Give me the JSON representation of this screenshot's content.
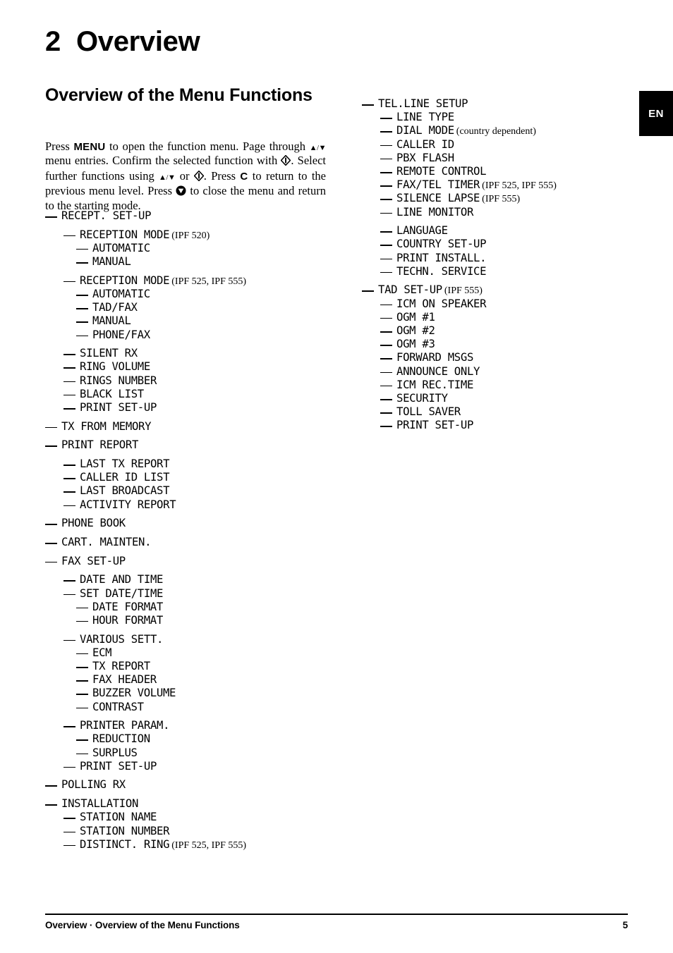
{
  "lang_tab": {
    "label": "EN"
  },
  "chapter": {
    "number": "2",
    "title": "Overview"
  },
  "section": {
    "title": "Overview of the Menu Functions"
  },
  "intro": {
    "t1": "Press ",
    "menu_key": "MENU",
    "t2": " to open the function menu. Page through ",
    "arrows1": "▲/▼",
    "t3": " menu entries. Confirm the selected function with ",
    "ok_symbol": "ok-diamond",
    "t4": ". Select further functions using ",
    "arrows2": "▲/▼",
    "t5": " or ",
    "ok_symbol2": "ok-diamond",
    "t6": ". Press ",
    "c_key": "C",
    "t7": " to return to the previous menu level. Press ",
    "stop_symbol": "stop-circle",
    "t8": " to close the menu and return to the starting mode."
  },
  "left_column": [
    {
      "level": 1,
      "label": "RECEPT. SET-UP",
      "note": "",
      "gap": false
    },
    {
      "level": 2,
      "label": "RECEPTION MODE",
      "note": "(IPF 520)",
      "gap": true
    },
    {
      "level": 3,
      "label": "AUTOMATIC",
      "note": "",
      "gap": false
    },
    {
      "level": 3,
      "label": "MANUAL",
      "note": "",
      "gap": false
    },
    {
      "level": 2,
      "label": "RECEPTION MODE",
      "note": "(IPF 525, IPF 555)",
      "gap": true
    },
    {
      "level": 3,
      "label": "AUTOMATIC",
      "note": "",
      "gap": false
    },
    {
      "level": 3,
      "label": "TAD/FAX",
      "note": "",
      "gap": false
    },
    {
      "level": 3,
      "label": "MANUAL",
      "note": "",
      "gap": false
    },
    {
      "level": 3,
      "label": "PHONE/FAX",
      "note": "",
      "gap": false
    },
    {
      "level": 2,
      "label": "SILENT RX",
      "note": "",
      "gap": true
    },
    {
      "level": 2,
      "label": "RING VOLUME",
      "note": "",
      "gap": false
    },
    {
      "level": 2,
      "label": "RINGS NUMBER",
      "note": "",
      "gap": false
    },
    {
      "level": 2,
      "label": "BLACK LIST",
      "note": "",
      "gap": false
    },
    {
      "level": 2,
      "label": "PRINT SET-UP",
      "note": "",
      "gap": false
    },
    {
      "level": 1,
      "label": "TX FROM MEMORY",
      "note": "",
      "gap": true
    },
    {
      "level": 1,
      "label": "PRINT REPORT",
      "note": "",
      "gap": true
    },
    {
      "level": 2,
      "label": "LAST TX REPORT",
      "note": "",
      "gap": true
    },
    {
      "level": 2,
      "label": "CALLER ID LIST",
      "note": "",
      "gap": false
    },
    {
      "level": 2,
      "label": "LAST BROADCAST",
      "note": "",
      "gap": false
    },
    {
      "level": 2,
      "label": "ACTIVITY REPORT",
      "note": "",
      "gap": false
    },
    {
      "level": 1,
      "label": "PHONE BOOK",
      "note": "",
      "gap": true
    },
    {
      "level": 1,
      "label": "CART. MAINTEN.",
      "note": "",
      "gap": true
    },
    {
      "level": 1,
      "label": "FAX SET-UP",
      "note": "",
      "gap": true
    },
    {
      "level": 2,
      "label": "DATE AND TIME",
      "note": "",
      "gap": true
    },
    {
      "level": 2,
      "label": "SET DATE/TIME",
      "note": "",
      "gap": false
    },
    {
      "level": 3,
      "label": "DATE FORMAT",
      "note": "",
      "gap": false
    },
    {
      "level": 3,
      "label": "HOUR FORMAT",
      "note": "",
      "gap": false
    },
    {
      "level": 2,
      "label": "VARIOUS SETT.",
      "note": "",
      "gap": true
    },
    {
      "level": 3,
      "label": "ECM",
      "note": "",
      "gap": false
    },
    {
      "level": 3,
      "label": "TX REPORT",
      "note": "",
      "gap": false
    },
    {
      "level": 3,
      "label": "FAX HEADER",
      "note": "",
      "gap": false
    },
    {
      "level": 3,
      "label": "BUZZER VOLUME",
      "note": "",
      "gap": false
    },
    {
      "level": 3,
      "label": "CONTRAST",
      "note": "",
      "gap": false
    },
    {
      "level": 2,
      "label": "PRINTER PARAM.",
      "note": "",
      "gap": true
    },
    {
      "level": 3,
      "label": "REDUCTION",
      "note": "",
      "gap": false
    },
    {
      "level": 3,
      "label": "SURPLUS",
      "note": "",
      "gap": false
    },
    {
      "level": 2,
      "label": "PRINT SET-UP",
      "note": "",
      "gap": false
    },
    {
      "level": 1,
      "label": "POLLING RX",
      "note": "",
      "gap": true
    },
    {
      "level": 1,
      "label": "INSTALLATION",
      "note": "",
      "gap": true
    },
    {
      "level": 2,
      "label": "STATION NAME",
      "note": "",
      "gap": false
    },
    {
      "level": 2,
      "label": "STATION NUMBER",
      "note": "",
      "gap": false
    },
    {
      "level": 2,
      "label": "DISTINCT. RING",
      "note": "(IPF 525, IPF 555)",
      "gap": false
    }
  ],
  "right_column": [
    {
      "level": 1,
      "label": "TEL.LINE SETUP",
      "note": "",
      "gap": false
    },
    {
      "level": 2,
      "label": "LINE TYPE",
      "note": "",
      "gap": false
    },
    {
      "level": 2,
      "label": "DIAL MODE",
      "note": "(country dependent)",
      "gap": false
    },
    {
      "level": 2,
      "label": "CALLER ID",
      "note": "",
      "gap": false
    },
    {
      "level": 2,
      "label": "PBX FLASH",
      "note": "",
      "gap": false
    },
    {
      "level": 2,
      "label": "REMOTE CONTROL",
      "note": "",
      "gap": false
    },
    {
      "level": 2,
      "label": "FAX/TEL TIMER",
      "note": "(IPF 525, IPF 555)",
      "gap": false
    },
    {
      "level": 2,
      "label": "SILENCE LAPSE",
      "note": "(IPF 555)",
      "gap": false
    },
    {
      "level": 2,
      "label": "LINE MONITOR",
      "note": "",
      "gap": false
    },
    {
      "level": 2,
      "label": "LANGUAGE",
      "note": "",
      "gap": true
    },
    {
      "level": 2,
      "label": "COUNTRY SET-UP",
      "note": "",
      "gap": false
    },
    {
      "level": 2,
      "label": "PRINT INSTALL.",
      "note": "",
      "gap": false
    },
    {
      "level": 2,
      "label": "TECHN. SERVICE",
      "note": "",
      "gap": false
    },
    {
      "level": 1,
      "label": "TAD SET-UP",
      "note": "(IPF 555)",
      "gap": true
    },
    {
      "level": 2,
      "label": "ICM ON SPEAKER",
      "note": "",
      "gap": false
    },
    {
      "level": 2,
      "label": "OGM #1",
      "note": "",
      "gap": false
    },
    {
      "level": 2,
      "label": "OGM #2",
      "note": "",
      "gap": false
    },
    {
      "level": 2,
      "label": "OGM #3",
      "note": "",
      "gap": false
    },
    {
      "level": 2,
      "label": "FORWARD MSGS",
      "note": "",
      "gap": false
    },
    {
      "level": 2,
      "label": "ANNOUNCE ONLY",
      "note": "",
      "gap": false
    },
    {
      "level": 2,
      "label": "ICM REC.TIME",
      "note": "",
      "gap": false
    },
    {
      "level": 2,
      "label": "SECURITY",
      "note": "",
      "gap": false
    },
    {
      "level": 2,
      "label": "TOLL SAVER",
      "note": "",
      "gap": false
    },
    {
      "level": 2,
      "label": "PRINT SET-UP",
      "note": "",
      "gap": false
    }
  ],
  "footer": {
    "breadcrumb": "Overview · Overview of the Menu Functions",
    "page_number": "5"
  }
}
